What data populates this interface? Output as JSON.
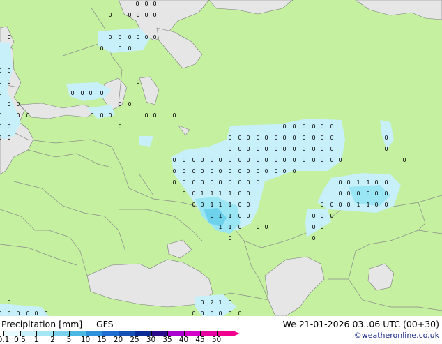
{
  "map": {
    "colors": {
      "land": "#c4f0a0",
      "sea": "#e6e6e6",
      "outside": "#e6e6e6",
      "border": "#8c8c8c",
      "coast": "#7a7a7a",
      "precip_light": "#c8f0fa",
      "precip_mid": "#9be6f5",
      "precip_heavy": "#6fd2ec"
    },
    "precip_cells": [
      {
        "amount": 0.1,
        "intensity": "light"
      },
      {
        "amount": 1,
        "intensity": "mid"
      },
      {
        "amount": 2,
        "intensity": "mid"
      }
    ]
  },
  "footer": {
    "title": "Precipitation [mm]",
    "model": "GFS",
    "datetime": "We 21-01-2026 03..06 UTC (00+30)",
    "credit": "©weatheronline.co.uk"
  },
  "legend": {
    "labels": [
      "0.1",
      "0.5",
      "1",
      "2",
      "5",
      "10",
      "15",
      "20",
      "25",
      "30",
      "35",
      "40",
      "45",
      "50"
    ],
    "colors": [
      "#e6fafe",
      "#c8f0fa",
      "#a5e6f5",
      "#78d2ee",
      "#4bb8e4",
      "#2d91dc",
      "#1e6ed2",
      "#1450b4",
      "#0a2a96",
      "#2a0a8a",
      "#aa00d2",
      "#d200c8",
      "#e600a0",
      "#f0008c"
    ]
  }
}
